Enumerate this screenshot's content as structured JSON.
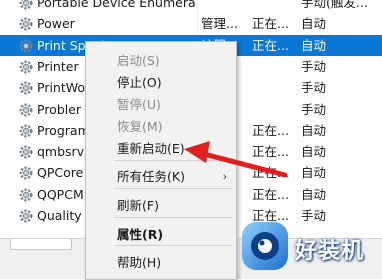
{
  "services": [
    {
      "name": "Portable Device Enumera...",
      "desc": "",
      "status": "",
      "startup": "手动(触发..."
    },
    {
      "name": "Power",
      "desc": "管理...",
      "status": "正在...",
      "startup": "自动"
    },
    {
      "name": "Print Spooler",
      "desc": "该服...",
      "status": "正在...",
      "startup": "自动",
      "selected": true
    },
    {
      "name": "Printer",
      "desc": "",
      "status": "",
      "startup": "手动"
    },
    {
      "name": "PrintWo",
      "desc": "",
      "status": "",
      "startup": "手动"
    },
    {
      "name": "Probler",
      "desc": "",
      "status": "",
      "startup": "手动"
    },
    {
      "name": "Program",
      "desc": "",
      "status": "正在...",
      "startup": "自动"
    },
    {
      "name": "qmbsrv",
      "desc": "",
      "status": "正在...",
      "startup": "自动"
    },
    {
      "name": "QPCore",
      "desc": "",
      "status": "正在...",
      "startup": "自动"
    },
    {
      "name": "QQPCM",
      "desc": "",
      "status": "正在...",
      "startup": "自动"
    },
    {
      "name": "Quality",
      "desc": "",
      "status": "正在...",
      "startup": "手动"
    }
  ],
  "context_menu": {
    "items": [
      {
        "label": "启动(S)",
        "disabled": true
      },
      {
        "label": "停止(O)",
        "disabled": false
      },
      {
        "label": "暂停(U)",
        "disabled": true
      },
      {
        "label": "恢复(M)",
        "disabled": true
      },
      {
        "label": "重新启动(E)",
        "disabled": false
      },
      {
        "label": "所有任务(K)",
        "disabled": false,
        "submenu": true
      },
      {
        "label": "刷新(F)",
        "disabled": false
      },
      {
        "label": "属性(R)",
        "disabled": false,
        "bold": true
      },
      {
        "label": "帮助(H)",
        "disabled": false
      }
    ]
  },
  "annotation": {
    "arrow_color": "#e02020"
  },
  "watermark": {
    "text": "好装机"
  },
  "colors": {
    "selection": "#0a78d7",
    "menu_bg": "#f2f2f2"
  }
}
